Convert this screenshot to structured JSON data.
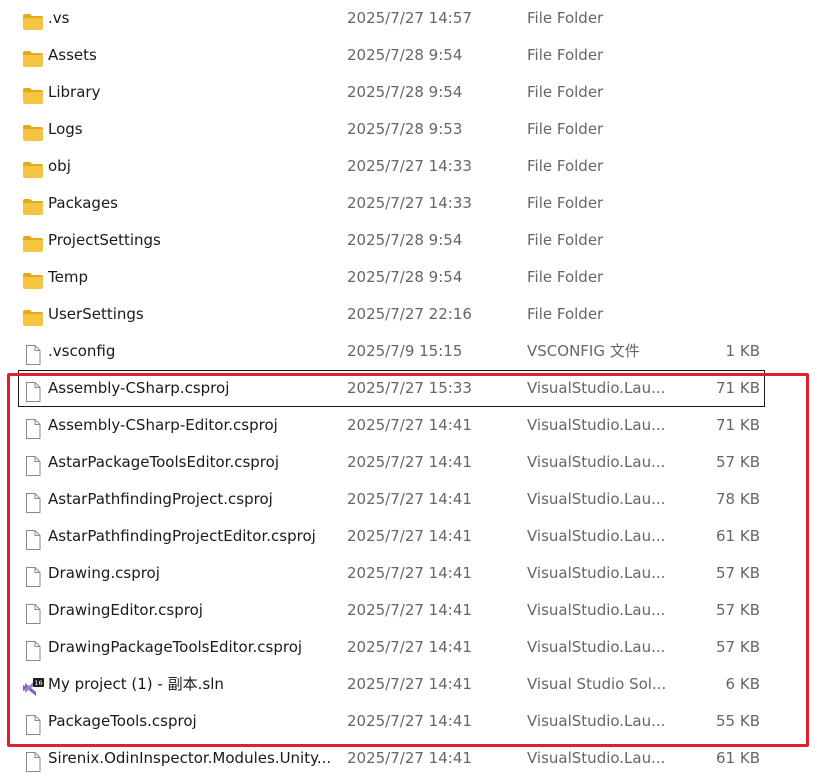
{
  "colors": {
    "folder": "#f5c542",
    "folder_dark": "#e3a91c",
    "highlight": "#e02030",
    "vs_purple": "#865fc5"
  },
  "files": [
    {
      "name": ".vs",
      "date": "2025/7/27 14:57",
      "type": "File Folder",
      "size": "",
      "icon": "folder-icon"
    },
    {
      "name": "Assets",
      "date": "2025/7/28 9:54",
      "type": "File Folder",
      "size": "",
      "icon": "folder-icon"
    },
    {
      "name": "Library",
      "date": "2025/7/28 9:54",
      "type": "File Folder",
      "size": "",
      "icon": "folder-icon"
    },
    {
      "name": "Logs",
      "date": "2025/7/28 9:53",
      "type": "File Folder",
      "size": "",
      "icon": "folder-icon"
    },
    {
      "name": "obj",
      "date": "2025/7/27 14:33",
      "type": "File Folder",
      "size": "",
      "icon": "folder-icon"
    },
    {
      "name": "Packages",
      "date": "2025/7/27 14:33",
      "type": "File Folder",
      "size": "",
      "icon": "folder-icon"
    },
    {
      "name": "ProjectSettings",
      "date": "2025/7/28 9:54",
      "type": "File Folder",
      "size": "",
      "icon": "folder-icon"
    },
    {
      "name": "Temp",
      "date": "2025/7/28 9:54",
      "type": "File Folder",
      "size": "",
      "icon": "folder-icon"
    },
    {
      "name": "UserSettings",
      "date": "2025/7/27 22:16",
      "type": "File Folder",
      "size": "",
      "icon": "folder-icon"
    },
    {
      "name": ".vsconfig",
      "date": "2025/7/9 15:15",
      "type": "VSCONFIG 文件",
      "size": "1 KB",
      "icon": "file-icon"
    },
    {
      "name": "Assembly-CSharp.csproj",
      "date": "2025/7/27 15:33",
      "type": "VisualStudio.Lau...",
      "size": "71 KB",
      "icon": "file-icon",
      "focused": true
    },
    {
      "name": "Assembly-CSharp-Editor.csproj",
      "date": "2025/7/27 14:41",
      "type": "VisualStudio.Lau...",
      "size": "71 KB",
      "icon": "file-icon"
    },
    {
      "name": "AstarPackageToolsEditor.csproj",
      "date": "2025/7/27 14:41",
      "type": "VisualStudio.Lau...",
      "size": "57 KB",
      "icon": "file-icon"
    },
    {
      "name": "AstarPathfindingProject.csproj",
      "date": "2025/7/27 14:41",
      "type": "VisualStudio.Lau...",
      "size": "78 KB",
      "icon": "file-icon"
    },
    {
      "name": "AstarPathfindingProjectEditor.csproj",
      "date": "2025/7/27 14:41",
      "type": "VisualStudio.Lau...",
      "size": "61 KB",
      "icon": "file-icon"
    },
    {
      "name": "Drawing.csproj",
      "date": "2025/7/27 14:41",
      "type": "VisualStudio.Lau...",
      "size": "57 KB",
      "icon": "file-icon"
    },
    {
      "name": "DrawingEditor.csproj",
      "date": "2025/7/27 14:41",
      "type": "VisualStudio.Lau...",
      "size": "57 KB",
      "icon": "file-icon"
    },
    {
      "name": "DrawingPackageToolsEditor.csproj",
      "date": "2025/7/27 14:41",
      "type": "VisualStudio.Lau...",
      "size": "57 KB",
      "icon": "file-icon"
    },
    {
      "name": "My project (1) - 副本.sln",
      "date": "2025/7/27 14:41",
      "type": "Visual Studio Sol...",
      "size": "6 KB",
      "icon": "visual-studio-solution-icon",
      "badge": "16"
    },
    {
      "name": "PackageTools.csproj",
      "date": "2025/7/27 14:41",
      "type": "VisualStudio.Lau...",
      "size": "55 KB",
      "icon": "file-icon"
    },
    {
      "name": "Sirenix.OdinInspector.Modules.Unity...",
      "date": "2025/7/27 14:41",
      "type": "VisualStudio.Lau...",
      "size": "61 KB",
      "icon": "file-icon"
    }
  ]
}
